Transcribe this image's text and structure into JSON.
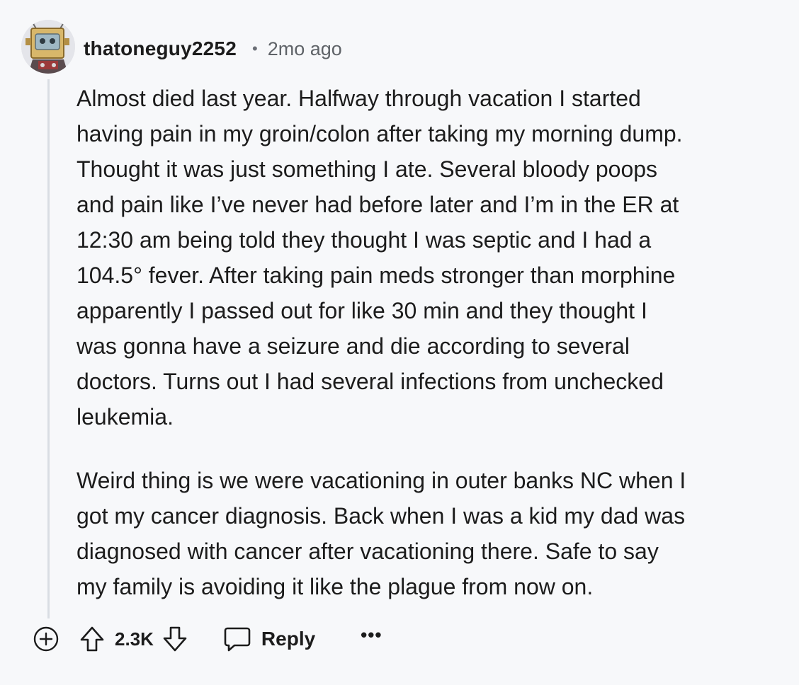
{
  "comment": {
    "username": "thatoneguy2252",
    "separator": "•",
    "timestamp": "2mo ago",
    "paragraphs": [
      {
        "lines": [
          "Almost died last year. Halfway through vacation I started",
          "having pain in my groin/colon after taking my morning dump.",
          "Thought it was just something I ate. Several bloody poops",
          "and pain like I’ve never had before later and I’m in the ER at",
          "12:30 am being told they thought I was septic and I had a",
          "104.5° fever. After taking pain meds stronger than morphine",
          "apparently I passed out for like 30 min and they thought I",
          "was gonna have a seizure and die according to several",
          "doctors. Turns out I had several infections from unchecked",
          "leukemia."
        ]
      },
      {
        "lines": [
          "Weird thing is we were vacationing in outer banks NC when I",
          "got my cancer diagnosis. Back when I was a kid my dad was",
          "diagnosed with cancer after vacationing there. Safe to say",
          "my family is avoiding it like the plague from now on."
        ]
      }
    ],
    "actions": {
      "expand_icon": "plus-circle-icon",
      "upvote_icon": "arrow-up-icon",
      "score": "2.3K",
      "downvote_icon": "arrow-down-icon",
      "reply_icon": "speech-bubble-icon",
      "reply_label": "Reply",
      "more_label": "•••"
    }
  }
}
